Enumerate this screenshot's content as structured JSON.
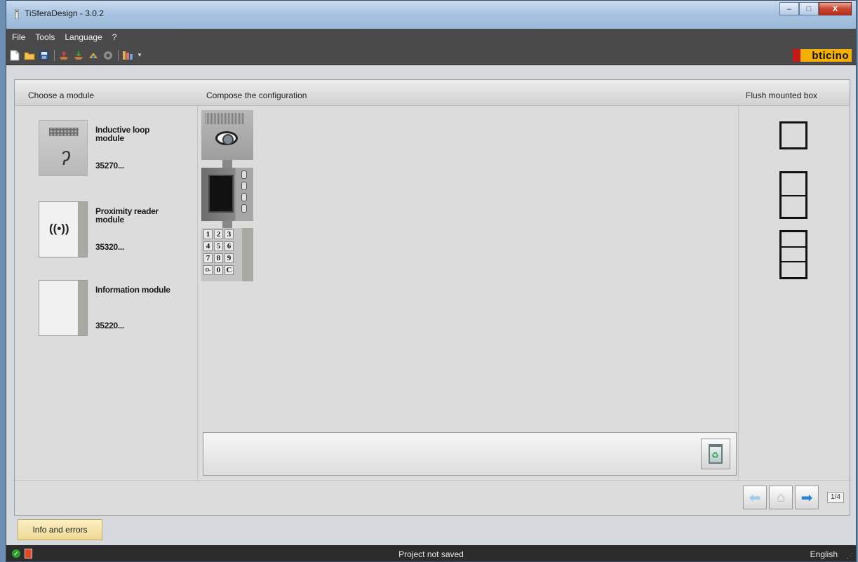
{
  "window": {
    "title": "TiSferaDesign - 3.0.2",
    "controls": {
      "minimize": "–",
      "maximize": "□",
      "close": "X"
    }
  },
  "menu": [
    "File",
    "Tools",
    "Language",
    "?"
  ],
  "toolbar": {
    "icons": [
      "new-file-icon",
      "open-folder-icon",
      "save-icon",
      "export-icon",
      "import-icon",
      "update-icon",
      "settings-icon",
      "palette-icon"
    ],
    "dropdown_glyph": "▾"
  },
  "brand": {
    "text": "bticino"
  },
  "panel": {
    "left_header": "Choose a module",
    "mid_header": "Compose the configuration",
    "right_header": "Flush mounted box"
  },
  "modules": [
    {
      "name": "Inductive loop module",
      "code": "35270..."
    },
    {
      "name": "Proximity reader module",
      "code": "35320..."
    },
    {
      "name": "Information module",
      "code": "35220..."
    }
  ],
  "icon_glyphs": {
    "ear": "ʔ",
    "proximity": "((•))"
  },
  "keypad_keys": [
    "1",
    "2",
    "3",
    "4",
    "5",
    "6",
    "7",
    "8",
    "9",
    "O‐",
    "0",
    "C"
  ],
  "flush_boxes": [
    1,
    2,
    3
  ],
  "navigation": {
    "page": "1/4",
    "prev": "⬅",
    "home": "⌂",
    "next": "➡"
  },
  "info_tab": "Info and errors",
  "status": {
    "ok_glyph": "✓",
    "text": "Project not saved",
    "language": "English",
    "grip": "⋰"
  }
}
